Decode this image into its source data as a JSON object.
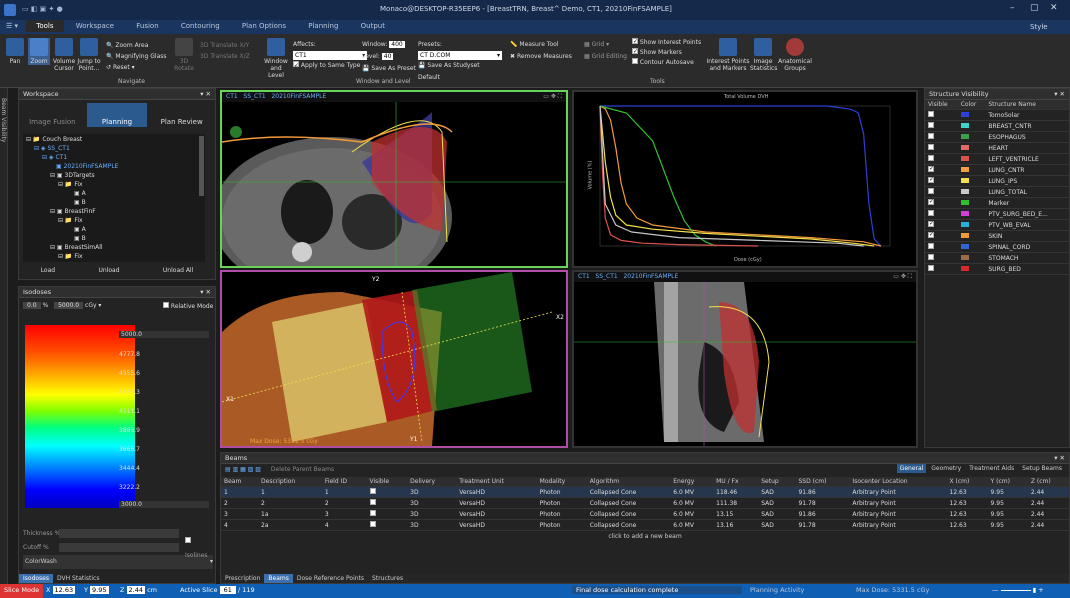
{
  "titlebar": {
    "title": "Monaco@DESKTOP-R35EEP6 - [BreastTRN, Breast^ Demo, CT1, 20210FinFSAMPLE]",
    "style": "Style"
  },
  "tabs": [
    "Tools",
    "Workspace",
    "Fusion",
    "Contouring",
    "Plan Options",
    "Planning",
    "Output"
  ],
  "ribbon": {
    "pan": "Pan",
    "zoom": "Zoom",
    "volume_cursor": "Volume Cursor",
    "jump_to_point": "Jump to Point...",
    "zoom_area": "Zoom Area",
    "magnifying_glass": "Magnifying Glass",
    "reset": "Reset",
    "rotate_3d": "3D Rotate",
    "translate_xy": "3D Translate X/Y",
    "translate_xz": "3D Translate X/Z",
    "navigate": "Navigate",
    "window_level": "Window and Level",
    "affects_label": "Affects:",
    "affects_value": "CT1",
    "apply_same": "Apply to Same Type",
    "window_label": "Window:",
    "window_value": "400",
    "level_label": "Level:",
    "level_value": "40",
    "presets_label": "Presets:",
    "presets_value": "CT D.COM",
    "save_preset": "Save As Preset",
    "save_default": "Save As Studyset Default",
    "window_level_group": "Window and Level",
    "measure_tool": "Measure Tool",
    "remove_measures": "Remove Measures",
    "grid": "Grid",
    "grid_editing": "Grid Editing",
    "show_interest_points": "Show Interest Points",
    "show_markers": "Show Markers",
    "contour_autosave": "Contour Autosave",
    "interest_points": "Interest Points and Markers",
    "image_statistics": "Image Statistics",
    "anatomical_groups": "Anatomical Groups",
    "tools_group": "Tools"
  },
  "sidebar_label": "Beam Visibility",
  "workspace": {
    "title": "Workspace",
    "buttons": [
      "Image Fusion",
      "Planning",
      "Plan Review"
    ],
    "tree": [
      "Couch Breast",
      "SS_CT1",
      "CT1",
      "20210FinFSAMPLE",
      "3DTargets",
      "Fix",
      "A",
      "B",
      "BreastFinF",
      "Fix",
      "A",
      "B",
      "BreastSimAll",
      "Fix"
    ],
    "actions": [
      "Load",
      "Unload",
      "Unload All"
    ]
  },
  "isodoses": {
    "title": "Isodoses",
    "pct": "0.0",
    "unit": "%",
    "val": "5000.0",
    "cgy": "cGy",
    "relative": "Relative Mode",
    "labels": [
      "5000.0",
      "4777.8",
      "4555.6",
      "4333.3",
      "4111.1",
      "3888.9",
      "3666.7",
      "3444.4",
      "3222.2",
      "3000.0"
    ],
    "thickness": "Thickness %",
    "cutoff": "Cutoff %",
    "isolines": "Isolines",
    "colorwash": "ColorWash",
    "tabs": [
      "Isodoses",
      "DVH Statistics"
    ]
  },
  "viewports": {
    "v1": {
      "tabs": [
        "CT1",
        "SS_CT1",
        "20210FinFSAMPLE"
      ]
    },
    "v2": {
      "title": "Total Volume DVH",
      "ylabel": "Volume (%)",
      "xlabel": "Dose (cGy)"
    },
    "v3": {
      "max_dose": "Max Dose: 5331.5 cGy",
      "x1": "X1",
      "x2": "X2",
      "y1": "Y1",
      "y2": "Y2"
    },
    "v4": {
      "tabs": [
        "CT1",
        "SS_CT1",
        "20210FinFSAMPLE"
      ]
    }
  },
  "structures": {
    "title": "Structure Visibility",
    "headers": [
      "Visible",
      "Color",
      "Structure Name"
    ],
    "rows": [
      {
        "name": "TomoSolar",
        "color": "#2f3fd6",
        "on": false
      },
      {
        "name": "BREAST_CNTR",
        "color": "#3fd3d0",
        "on": false
      },
      {
        "name": "ESOPHAGUS",
        "color": "#3aa04a",
        "on": false
      },
      {
        "name": "HEART",
        "color": "#e06a6a",
        "on": false
      },
      {
        "name": "LEFT_VENTRICLE",
        "color": "#d9534f",
        "on": false
      },
      {
        "name": "LUNG_CNTR",
        "color": "#f0a040",
        "on": true
      },
      {
        "name": "LUNG_IPS",
        "color": "#f2e14c",
        "on": true
      },
      {
        "name": "LUNG_TOTAL",
        "color": "#c8c8c8",
        "on": false
      },
      {
        "name": "Marker",
        "color": "#2fc02f",
        "on": true
      },
      {
        "name": "PTV_SURG_BED_E...",
        "color": "#d43fd4",
        "on": false
      },
      {
        "name": "PTV_WB_EVAL",
        "color": "#24b0d8",
        "on": true
      },
      {
        "name": "SKIN",
        "color": "#f29a3a",
        "on": true
      },
      {
        "name": "SPINAL_CORD",
        "color": "#3264d6",
        "on": false
      },
      {
        "name": "STOMACH",
        "color": "#9a6a4a",
        "on": false
      },
      {
        "name": "SURG_BED",
        "color": "#d42a2a",
        "on": false
      }
    ]
  },
  "beams": {
    "title": "Beams",
    "toolbar": "Delete Parent Beams",
    "right_tabs": [
      "General",
      "Geometry",
      "Treatment Aids",
      "Setup Beams"
    ],
    "headers": [
      "Beam",
      "Description",
      "Field ID",
      "Visible",
      "Delivery",
      "Treatment Unit",
      "Modality",
      "Algorithm",
      "Energy",
      "MU / Fx",
      "Setup",
      "SSD (cm)",
      "Isocenter Location",
      "X (cm)",
      "Y (cm)",
      "Z (cm)"
    ],
    "rows": [
      [
        "1",
        "1",
        "1",
        "3D",
        "VersaHD",
        "Photon",
        "Collapsed Cone",
        "6.0 MV",
        "118.46",
        "SAD",
        "91.86",
        "Arbitrary Point",
        "12.63",
        "9.95",
        "2.44"
      ],
      [
        "2",
        "2",
        "2",
        "3D",
        "VersaHD",
        "Photon",
        "Collapsed Cone",
        "6.0 MV",
        "111.38",
        "SAD",
        "91.78",
        "Arbitrary Point",
        "12.63",
        "9.95",
        "2.44"
      ],
      [
        "3",
        "1a",
        "3",
        "3D",
        "VersaHD",
        "Photon",
        "Collapsed Cone",
        "6.0 MV",
        "13.15",
        "SAD",
        "91.86",
        "Arbitrary Point",
        "12.63",
        "9.95",
        "2.44"
      ],
      [
        "4",
        "2a",
        "4",
        "3D",
        "VersaHD",
        "Photon",
        "Collapsed Cone",
        "6.0 MV",
        "13.16",
        "SAD",
        "91.78",
        "Arbitrary Point",
        "12.63",
        "9.95",
        "2.44"
      ]
    ],
    "add_row": "click to add a new beam",
    "bottom_tabs": [
      "Prescription",
      "Beams",
      "Dose Reference Points",
      "Structures"
    ]
  },
  "status": {
    "mode": "Slice Mode",
    "x": "12.63",
    "y": "9.95",
    "z": "2.44",
    "unit": "cm",
    "active_slice": "Active Slice",
    "slice": "61",
    "slices": "/ 119",
    "message": "Final dose calculation complete",
    "activity": "Planning Activity",
    "maxdose": "Max Dose: 5331.5 cGy"
  },
  "chart_data": {
    "type": "line",
    "title": "Total Volume DVH",
    "xlabel": "Dose (cGy)",
    "ylabel": "Volume (%)",
    "xlim": [
      0,
      5500
    ],
    "ylim": [
      0,
      100
    ],
    "series": [
      {
        "color": "#2f3fd6",
        "x": [
          0,
          4300,
          4500,
          4700,
          4800,
          4900,
          5000,
          5100,
          5200,
          5330
        ],
        "y": [
          100,
          100,
          99,
          98,
          97,
          95,
          80,
          30,
          5,
          0
        ]
      },
      {
        "color": "#f29a3a",
        "x": [
          0,
          100,
          200,
          300,
          400,
          500,
          700,
          1000,
          2000,
          3000,
          4000,
          5000,
          5330
        ],
        "y": [
          100,
          98,
          90,
          70,
          45,
          30,
          20,
          15,
          10,
          8,
          6,
          3,
          0
        ]
      },
      {
        "color": "#2fc02f",
        "x": [
          0,
          500,
          1000,
          1200,
          1400,
          1600,
          1800,
          2000,
          2200
        ],
        "y": [
          100,
          95,
          75,
          55,
          35,
          18,
          8,
          3,
          0
        ]
      },
      {
        "color": "#f2e14c",
        "x": [
          0,
          100,
          200,
          300,
          500,
          1000,
          2000,
          3000,
          4000,
          4800,
          5200
        ],
        "y": [
          100,
          60,
          35,
          22,
          15,
          12,
          9,
          7,
          5,
          2,
          0
        ]
      },
      {
        "color": "#d9534f",
        "x": [
          0,
          50,
          100,
          200,
          400,
          800,
          1500,
          3000
        ],
        "y": [
          100,
          50,
          20,
          8,
          4,
          2,
          1,
          0
        ]
      },
      {
        "color": "#c8c8c8",
        "x": [
          0,
          100,
          300,
          600,
          1500,
          3000,
          4500,
          5000
        ],
        "y": [
          100,
          30,
          15,
          10,
          6,
          4,
          2,
          0
        ]
      }
    ]
  }
}
